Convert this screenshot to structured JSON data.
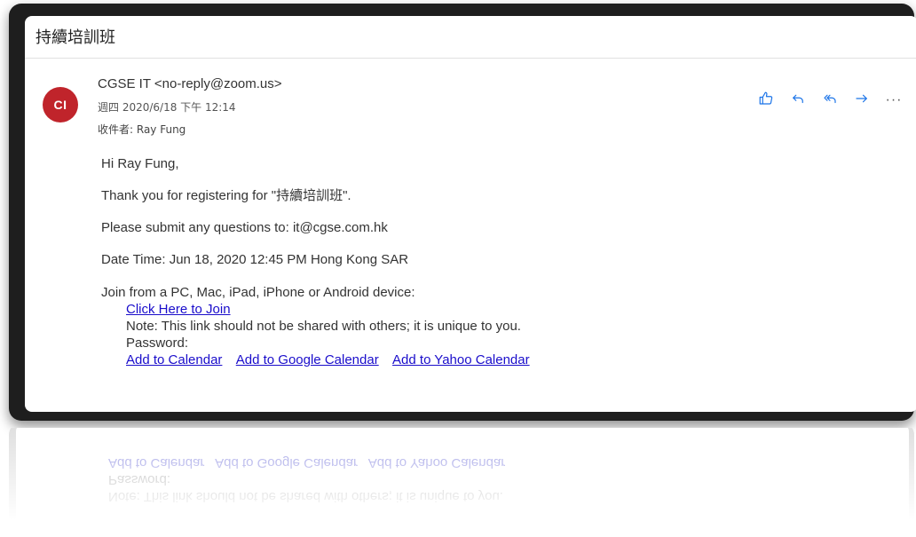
{
  "email": {
    "subject": "持續培訓班",
    "avatar_initials": "CI",
    "avatar_color": "#c0242b",
    "sender": "CGSE IT <no-reply@zoom.us>",
    "datetime": "週四 2020/6/18 下午 12:14",
    "to_label": "收件者:",
    "to_name": "Ray Fung"
  },
  "toolbar": {
    "icons": [
      "like-icon",
      "reply-icon",
      "reply-all-icon",
      "forward-icon",
      "more-icon"
    ],
    "more_label": "···",
    "accent": "#1a73e8"
  },
  "body": {
    "greeting": "Hi Ray Fung,",
    "thanks": "Thank you for registering for \"持續培訓班\".",
    "questions": "Please submit any questions to: it@cgse.com.hk",
    "datetime": "Date Time: Jun 18, 2020 12:45 PM Hong Kong SAR",
    "join_intro": "Join from a PC, Mac, iPad, iPhone or Android device:",
    "join_link": "Click Here to Join",
    "note": "Note: This link should not be shared with others; it is unique to you.",
    "password_label": "Password:",
    "calendar_links": [
      "Add to Calendar",
      "Add to Google Calendar",
      "Add to Yahoo Calendar"
    ],
    "link_color": "#1a0dcb"
  }
}
